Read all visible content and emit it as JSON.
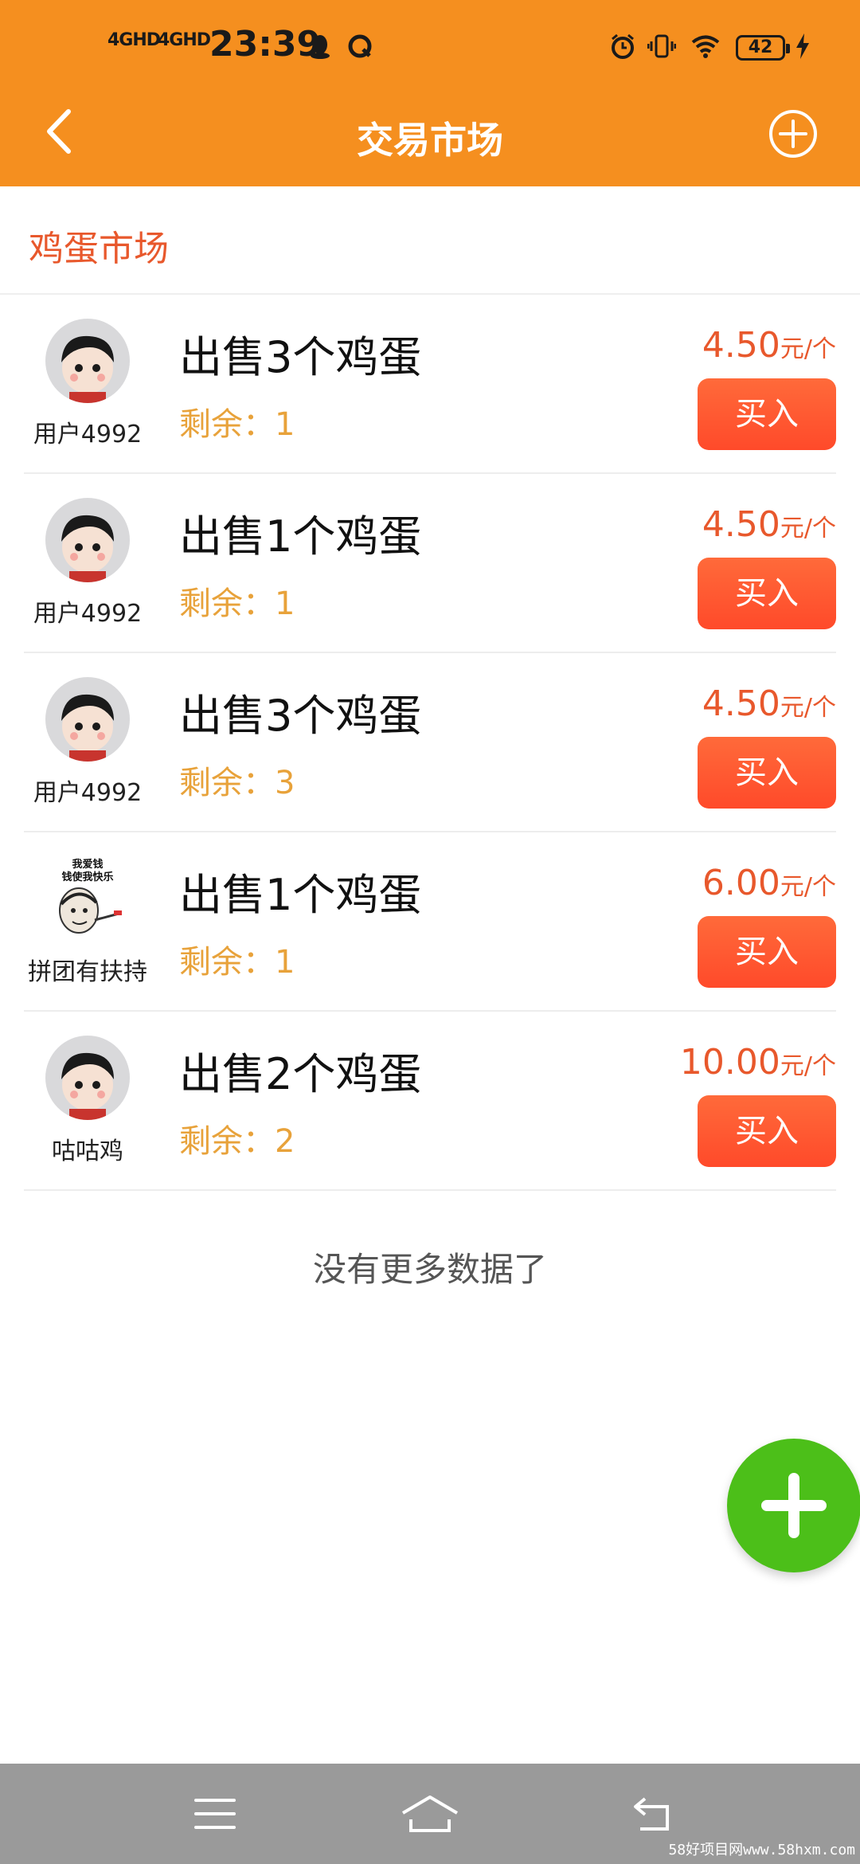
{
  "status_bar": {
    "net1": "4GHD",
    "net2": "4GHD",
    "time": "23:39",
    "battery": "42",
    "icons": [
      "qq-icon",
      "q-app-icon",
      "alarm-icon",
      "vibrate-icon",
      "wifi-icon",
      "charging-icon"
    ]
  },
  "nav": {
    "title": "交易市场",
    "back_icon": "chevron-left-icon",
    "add_icon": "plus-circle-icon"
  },
  "section": {
    "title": "鸡蛋市场"
  },
  "listings": [
    {
      "seller": "用户4992",
      "avatar": "cartoon-boy",
      "title": "出售3个鸡蛋",
      "remain_label": "剩余：",
      "remain": "1",
      "price": "4.50",
      "unit": "元/个",
      "buy": "买入"
    },
    {
      "seller": "用户4992",
      "avatar": "cartoon-boy",
      "title": "出售1个鸡蛋",
      "remain_label": "剩余：",
      "remain": "1",
      "price": "4.50",
      "unit": "元/个",
      "buy": "买入"
    },
    {
      "seller": "用户4992",
      "avatar": "cartoon-boy",
      "title": "出售3个鸡蛋",
      "remain_label": "剩余：",
      "remain": "3",
      "price": "4.50",
      "unit": "元/个",
      "buy": "买入"
    },
    {
      "seller": "拼团有扶持",
      "avatar": "meme",
      "avatar_text1": "我爱钱",
      "avatar_text2": "钱使我快乐",
      "title": "出售1个鸡蛋",
      "remain_label": "剩余：",
      "remain": "1",
      "price": "6.00",
      "unit": "元/个",
      "buy": "买入"
    },
    {
      "seller": "咕咕鸡",
      "avatar": "cartoon-boy",
      "title": "出售2个鸡蛋",
      "remain_label": "剩余：",
      "remain": "2",
      "price": "10.00",
      "unit": "元/个",
      "buy": "买入"
    }
  ],
  "footer": {
    "no_more": "没有更多数据了"
  },
  "fab": {
    "icon": "plus-icon"
  },
  "bottom_nav": {
    "icons": [
      "menu-icon",
      "home-icon",
      "back-icon"
    ]
  },
  "watermark": "58好项目网www.58hxm.com",
  "colors": {
    "header": "#f58f1f",
    "accent": "#e8582c",
    "remain": "#e8a23a",
    "buy": "#ff5230",
    "fab": "#4cbf19"
  }
}
